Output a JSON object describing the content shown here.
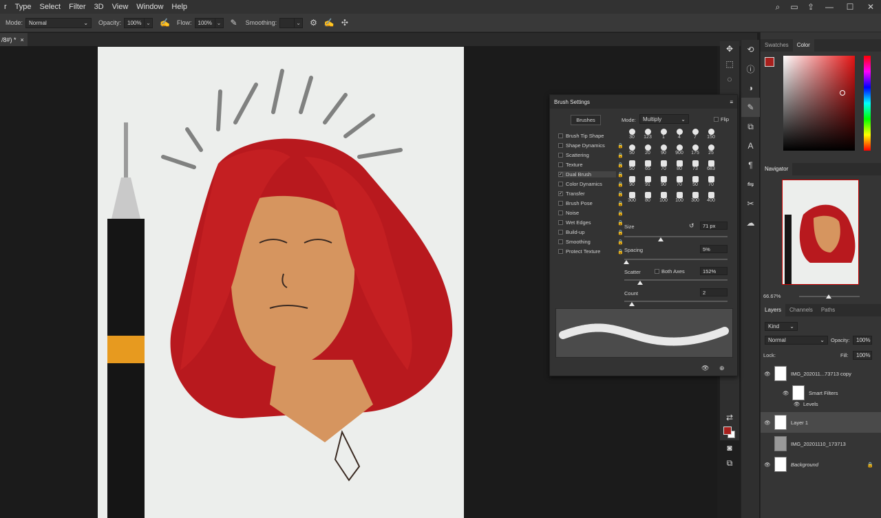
{
  "menu": [
    "r",
    "Type",
    "Select",
    "Filter",
    "3D",
    "View",
    "Window",
    "Help"
  ],
  "options_bar": {
    "mode_label": "Mode:",
    "mode_value": "Normal",
    "opacity_label": "Opacity:",
    "opacity_value": "100%",
    "flow_label": "Flow:",
    "flow_value": "100%",
    "smoothing_label": "Smoothing:"
  },
  "doc_tab": {
    "title": "/8#) *",
    "close": "×"
  },
  "brush_settings": {
    "title": "Brush Settings",
    "brushes_button": "Brushes",
    "mode_label": "Mode:",
    "mode_value": "Multiply",
    "flip_label": "Flip",
    "options": [
      {
        "label": "Brush Tip Shape",
        "checked": false
      },
      {
        "label": "Shape Dynamics",
        "checked": false
      },
      {
        "label": "Scattering",
        "checked": false
      },
      {
        "label": "Texture",
        "checked": false
      },
      {
        "label": "Dual Brush",
        "checked": true
      },
      {
        "label": "Color Dynamics",
        "checked": false
      },
      {
        "label": "Transfer",
        "checked": true
      },
      {
        "label": "Brush Pose",
        "checked": false
      },
      {
        "label": "Noise",
        "checked": false
      },
      {
        "label": "Wet Edges",
        "checked": false
      },
      {
        "label": "Build-up",
        "checked": false
      },
      {
        "label": "Smoothing",
        "checked": false
      },
      {
        "label": "Protect Texture",
        "checked": false
      }
    ],
    "brush_sizes": [
      [
        "30",
        "123",
        "1",
        "4",
        "7",
        "150"
      ],
      [
        "50",
        "20",
        "90",
        "900",
        "175",
        "25"
      ],
      [
        "50",
        "65",
        "70",
        "80",
        "73",
        "683"
      ],
      [
        "90",
        "91",
        "90",
        "70",
        "50",
        "70"
      ],
      [
        "300",
        "80",
        "100",
        "100",
        "300",
        "400"
      ]
    ],
    "size_label": "Size",
    "size_value": "71 px",
    "spacing_label": "Spacing",
    "spacing_value": "5%",
    "scatter_label": "Scatter",
    "both_axes_label": "Both Axes",
    "scatter_value": "152%",
    "count_label": "Count",
    "count_value": "2"
  },
  "color_panel": {
    "tabs": [
      "Swatches",
      "Color"
    ],
    "active_tab": "Color",
    "foreground": "#a8201d",
    "background": "#ffffff"
  },
  "navigator": {
    "title": "Navigator",
    "zoom": "66.67%"
  },
  "layers_panel": {
    "tabs": [
      "Layers",
      "Channels",
      "Paths"
    ],
    "kind_label": "Kind",
    "blend_value": "Normal",
    "opacity_label": "Opacity:",
    "opacity_value": "100%",
    "lock_label": "Lock:",
    "fill_label": "Fill:",
    "fill_value": "100%",
    "layers": [
      {
        "name": "IMG_202011...73713 copy",
        "visible": true
      },
      {
        "name": "Smart Filters",
        "visible": true
      },
      {
        "name": "Levels",
        "visible": true
      },
      {
        "name": "Layer 1",
        "visible": true
      },
      {
        "name": "IMG_20201110_173713",
        "visible": false
      },
      {
        "name": "Background",
        "visible": true
      }
    ]
  }
}
